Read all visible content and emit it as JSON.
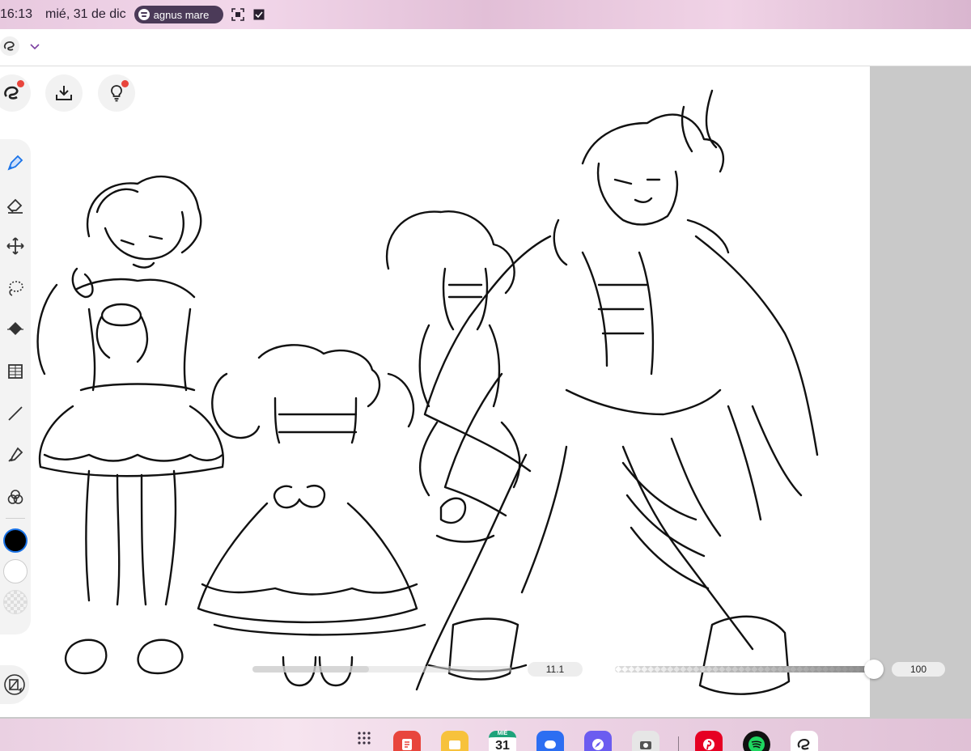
{
  "status_bar": {
    "time": "16:13",
    "date": "mié, 31 de dic",
    "media_title": "agnus mare"
  },
  "colors": {
    "accent_blue": "#1a73e8",
    "badge_red": "#e8453c",
    "primary_color": "#000000",
    "secondary_color": "#ffffff"
  },
  "toolbar": {
    "tools": [
      "pen-icon",
      "eraser-icon",
      "move-icon",
      "lasso-icon",
      "fill-icon",
      "transform-icon",
      "line-icon",
      "eyedropper-icon",
      "color-wheel-icon"
    ],
    "selected_tool": "pen-icon"
  },
  "brush": {
    "size_label": "11.1",
    "opacity_label": "100",
    "opacity_percent": 100
  },
  "dock": {
    "calendar_weekday": "MIÉ",
    "calendar_day": "31",
    "apps": [
      "app-drawer-icon",
      "notes-app-icon",
      "files-app-icon",
      "calendar-app-icon",
      "messages-app-icon",
      "browser-app-icon",
      "camera-app-icon",
      "pinterest-app-icon",
      "spotify-app-icon",
      "clip-studio-app-icon"
    ]
  }
}
